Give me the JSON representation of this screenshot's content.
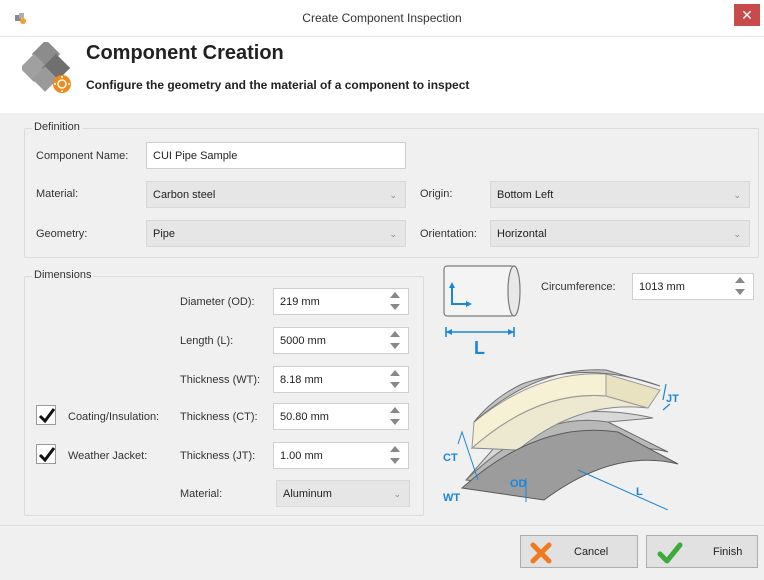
{
  "window": {
    "title": "Create Component Inspection",
    "close_glyph": "✕"
  },
  "header": {
    "title": "Component Creation",
    "subtitle": "Configure the geometry and the material of a component to inspect"
  },
  "definition": {
    "group_label": "Definition",
    "component_name_label": "Component Name:",
    "component_name_value": "CUI Pipe Sample",
    "material_label": "Material:",
    "material_value": "Carbon steel",
    "geometry_label": "Geometry:",
    "geometry_value": "Pipe",
    "origin_label": "Origin:",
    "origin_value": "Bottom Left",
    "orientation_label": "Orientation:",
    "orientation_value": "Horizontal"
  },
  "dimensions": {
    "group_label": "Dimensions",
    "diameter_label": "Diameter (OD):",
    "diameter_value": "219 mm",
    "length_label": "Length (L):",
    "length_value": "5000 mm",
    "thickness_wt_label": "Thickness (WT):",
    "thickness_wt_value": "8.18 mm",
    "coating_checkbox_label": "Coating/Insulation:",
    "coating_checked": true,
    "thickness_ct_label": "Thickness (CT):",
    "thickness_ct_value": "50.80 mm",
    "weather_checkbox_label": "Weather Jacket:",
    "weather_checked": true,
    "thickness_jt_label": "Thickness (JT):",
    "thickness_jt_value": "1.00 mm",
    "jacket_material_label": "Material:",
    "jacket_material_value": "Aluminum"
  },
  "diagram": {
    "circumference_label": "Circumference:",
    "circumference_value": "1013 mm",
    "length_symbol": "L",
    "labels": {
      "jt": "JT",
      "ct": "CT",
      "od": "OD",
      "wt": "WT",
      "l": "L"
    }
  },
  "footer": {
    "cancel_label": "Cancel",
    "finish_label": "Finish"
  },
  "colors": {
    "close_bg": "#c94a4a",
    "accent_blue": "#1a86d9",
    "cancel_orange": "#f07a22",
    "finish_green": "#3daa3d"
  }
}
